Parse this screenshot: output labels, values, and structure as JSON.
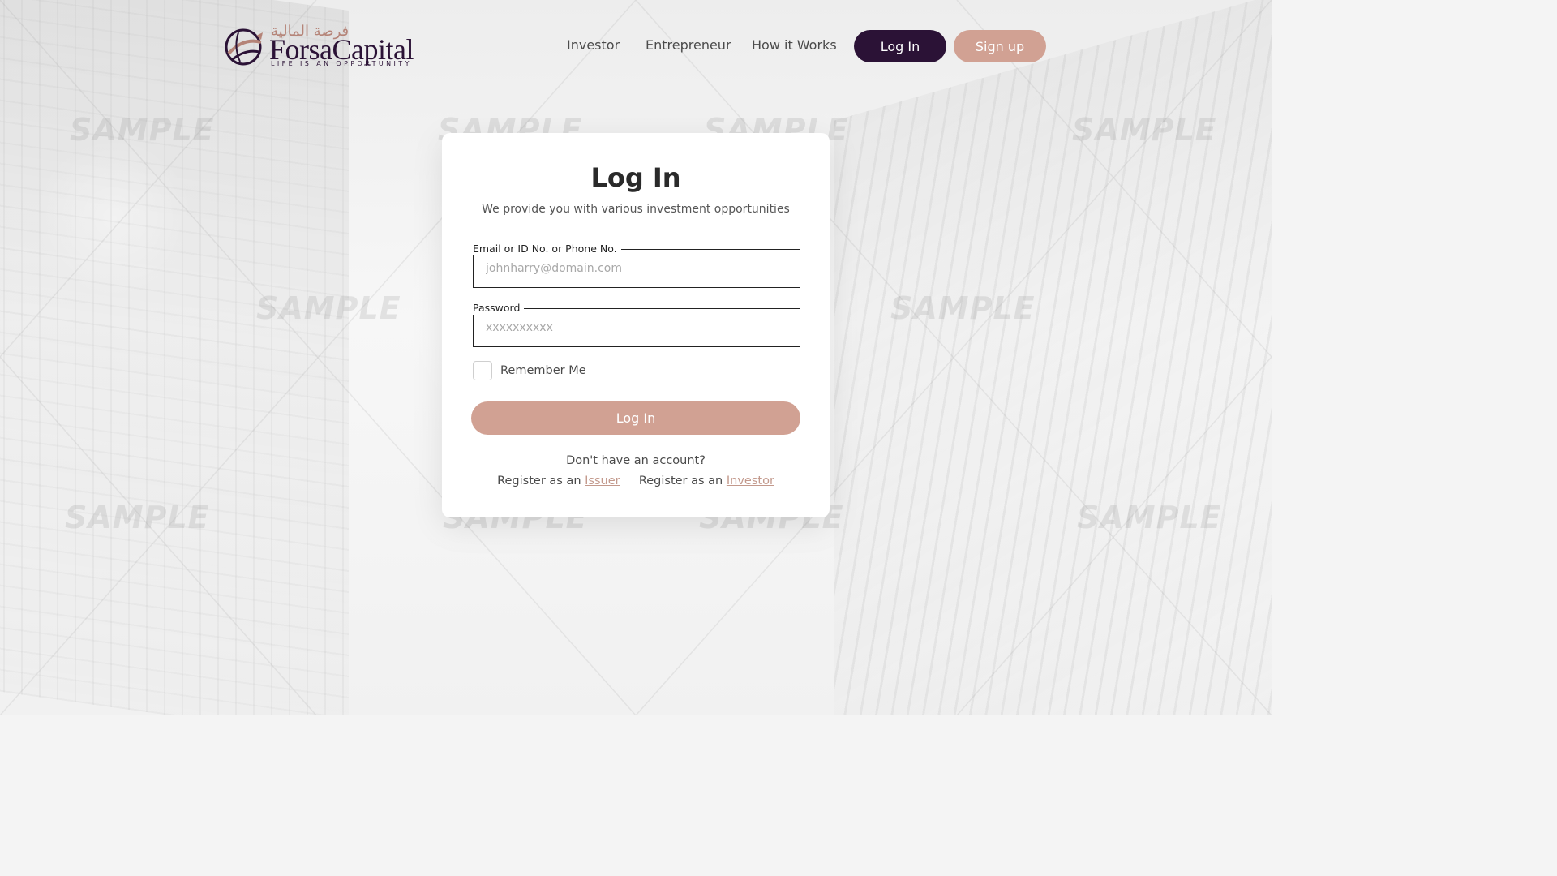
{
  "brand": {
    "arabic_name": "فرصة المالية",
    "name": "ForsaCapital",
    "tagline": "LIFE IS AN OPPORTUNITY"
  },
  "nav": {
    "items": [
      "Investor",
      "Entrepreneur",
      "How it Works"
    ],
    "login_label": "Log In",
    "signup_label": "Sign up"
  },
  "watermark": "SAMPLE",
  "login_card": {
    "title": "Log In",
    "subtitle": "We provide you with various investment opportunities",
    "email_label": "Email or ID No. or Phone No.",
    "email_placeholder": "johnharry@domain.com",
    "email_value": "",
    "password_label": "Password",
    "password_placeholder": "xxxxxxxxxx",
    "password_value": "",
    "remember_label": "Remember Me",
    "remember_checked": false,
    "submit_label": "Log In",
    "no_account_text": "Don't have an account?",
    "register_prefix_1": "Register as an",
    "register_link_1": "Issuer",
    "register_prefix_2": "Register as an",
    "register_link_2": "Investor"
  },
  "colors": {
    "brand_dark": "#2b1236",
    "brand_rose": "#d1a193",
    "link": "#c3998c"
  }
}
